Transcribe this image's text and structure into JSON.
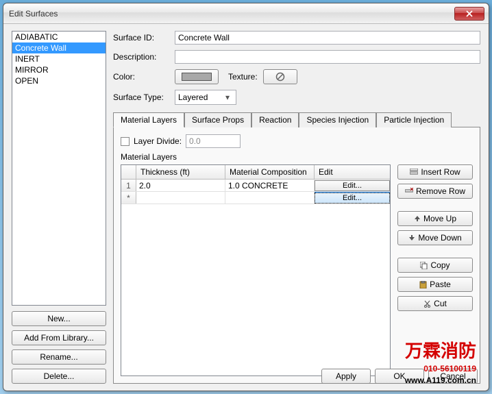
{
  "window": {
    "title": "Edit Surfaces"
  },
  "surfaceList": {
    "items": [
      "ADIABATIC",
      "Concrete Wall",
      "INERT",
      "MIRROR",
      "OPEN"
    ],
    "selectedIndex": 1
  },
  "leftButtons": {
    "new": "New...",
    "addFromLibrary": "Add From Library...",
    "rename": "Rename...",
    "delete": "Delete..."
  },
  "form": {
    "surfaceIdLabel": "Surface ID:",
    "surfaceIdValue": "Concrete Wall",
    "descriptionLabel": "Description:",
    "descriptionValue": "",
    "colorLabel": "Color:",
    "textureLabel": "Texture:",
    "surfaceTypeLabel": "Surface Type:",
    "surfaceTypeValue": "Layered"
  },
  "tabs": {
    "items": [
      "Material Layers",
      "Surface Props",
      "Reaction",
      "Species Injection",
      "Particle Injection"
    ],
    "activeIndex": 0
  },
  "layerDivide": {
    "label": "Layer Divide:",
    "value": "0.0",
    "checked": false
  },
  "materialLayers": {
    "groupLabel": "Material Layers",
    "columns": {
      "thickness": "Thickness (ft)",
      "composition": "Material Composition",
      "edit": "Edit"
    },
    "rows": [
      {
        "rowLabel": "1",
        "thickness": "2.0",
        "composition": "1.0 CONCRETE",
        "editLabel": "Edit..."
      },
      {
        "rowLabel": "*",
        "thickness": "",
        "composition": "",
        "editLabel": "Edit..."
      }
    ]
  },
  "sideButtons": {
    "insertRow": "Insert Row",
    "removeRow": "Remove Row",
    "moveUp": "Move Up",
    "moveDown": "Move Down",
    "copy": "Copy",
    "paste": "Paste",
    "cut": "Cut"
  },
  "footer": {
    "apply": "Apply",
    "ok": "OK",
    "cancel": "Cancel"
  },
  "watermark": {
    "line1": "万霖消防",
    "phone": "010-56100119",
    "url_pre": "www.",
    "url_red": "A119",
    "url_post": ".com.cn"
  }
}
